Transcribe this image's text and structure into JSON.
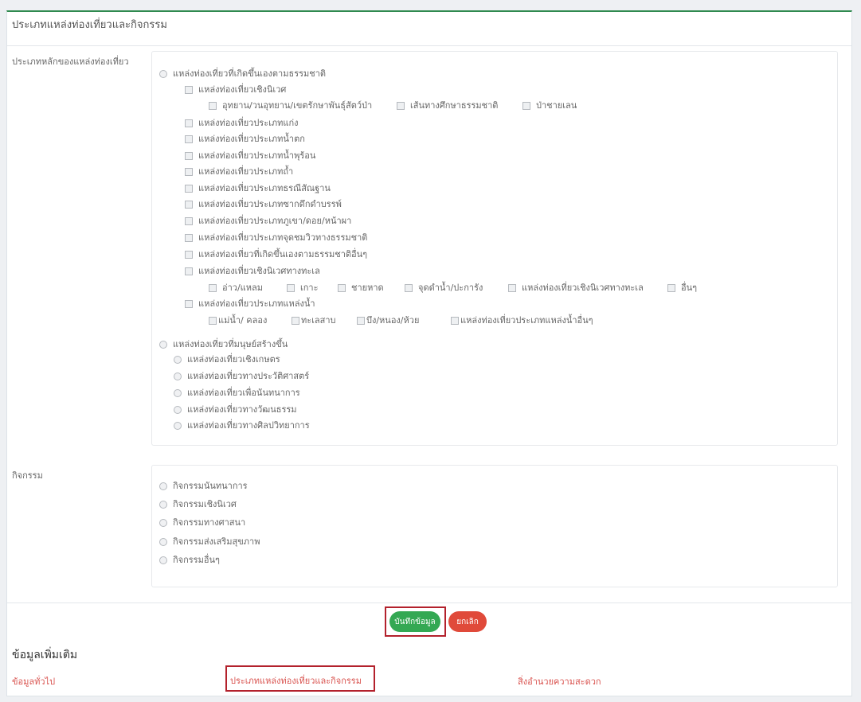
{
  "panel": {
    "title": "ประเภทแหล่งท่องเที่ยวและกิจกรรม"
  },
  "main_type": {
    "label": "ประเภทหลักของแหล่งท่องเที่ยว",
    "natural": {
      "label": "แหล่งท่องเที่ยวที่เกิดขึ้นเองตามธรรมชาติ",
      "eco": {
        "label": "แหล่งท่องเที่ยวเชิงนิเวศ",
        "items": [
          "อุทยาน/วนอุทยาน/เขตรักษาพันธุ์สัตว์ป่า",
          "เส้นทางศึกษาธรรมชาติ",
          "ป่าชายเลน"
        ]
      },
      "items": [
        "แหล่งท่องเที่ยวประเภทแก่ง",
        "แหล่งท่องเที่ยวประเภทน้ำตก",
        "แหล่งท่องเที่ยวประเภทน้ำพุร้อน",
        "แหล่งท่องเที่ยวประเภทถ้ำ",
        "แหล่งท่องเที่ยวประเภทธรณีสัณฐาน",
        "แหล่งท่องเที่ยวประเภทซากดึกดำบรรพ์",
        "แหล่งท่องเที่ยวประเภทภูเขา/ดอย/หน้าผา",
        "แหล่งท่องเที่ยวประเภทจุดชมวิวทางธรรมชาติ",
        "แหล่งท่องเที่ยวที่เกิดขึ้นเองตามธรรมชาติอื่นๆ"
      ],
      "marine": {
        "label": "แหล่งท่องเที่ยวเชิงนิเวศทางทะเล",
        "items": [
          "อ่าว/แหลม",
          "เกาะ",
          "ชายหาด",
          "จุดดำน้ำ/ปะการัง",
          "แหล่งท่องเที่ยวเชิงนิเวศทางทะเล",
          "อื่นๆ"
        ]
      },
      "water": {
        "label": "แหล่งท่องเที่ยวประเภทแหล่งน้ำ",
        "items": [
          "แม่น้ำ/ คลอง",
          "ทะเลสาบ",
          "บึง/หนอง/ห้วย",
          "แหล่งท่องเที่ยวประเภทแหล่งน้ำอื่นๆ"
        ]
      }
    },
    "manmade": {
      "label": "แหล่งท่องเที่ยวที่มนุษย์สร้างขึ้น",
      "items": [
        "แหล่งท่องเที่ยวเชิงเกษตร",
        "แหล่งท่องเที่ยวทางประวัติศาสตร์",
        "แหล่งท่องเที่ยวเพื่อนันทนาการ",
        "แหล่งท่องเที่ยวทางวัฒนธรรม",
        "แหล่งท่องเที่ยวทางศิลปวิทยาการ"
      ]
    }
  },
  "activities": {
    "label": "กิจกรรม",
    "items": [
      "กิจกรรมนันทนาการ",
      "กิจกรรมเชิงนิเวศ",
      "กิจกรรมทางศาสนา",
      "กิจกรรมส่งเสริมสุขภาพ",
      "กิจกรรมอื่นๆ"
    ]
  },
  "buttons": {
    "save": "บันทึกข้อมูล",
    "cancel": "ยกเลิก"
  },
  "more": {
    "title": "ข้อมูลเพิ่มเติม",
    "links": [
      "ข้อมูลทั่วไป",
      "ประเภทแหล่งท่องเที่ยวและกิจกรรม",
      "สิ่งอำนวยความสะดวก"
    ]
  },
  "colors": {
    "save": "#34a853",
    "cancel": "#e04a3a",
    "highlight": "#b3212c",
    "link": "#d9534f",
    "accent": "#2f8a4f"
  }
}
